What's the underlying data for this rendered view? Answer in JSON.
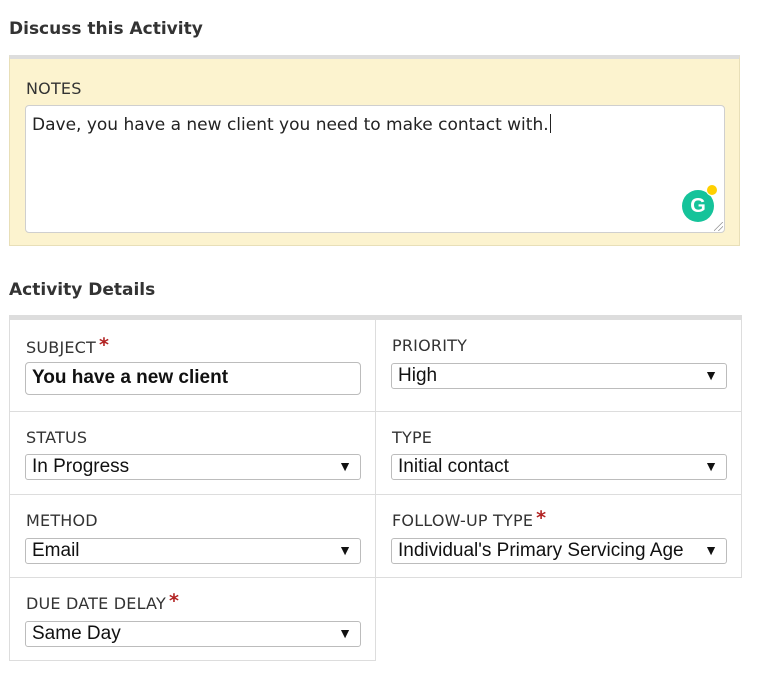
{
  "discuss": {
    "title": "Discuss this Activity",
    "notes_label": "NOTES",
    "notes_value": "Dave, you have a new client you need to make contact with."
  },
  "details": {
    "title": "Activity Details",
    "required_mark": "*",
    "arrow_glyph": "▼",
    "subject": {
      "label": "SUBJECT",
      "value": "You have a new client",
      "required": true
    },
    "priority": {
      "label": "PRIORITY",
      "value": "High"
    },
    "status": {
      "label": "STATUS",
      "value": "In Progress"
    },
    "type": {
      "label": "TYPE",
      "value": "Initial contact"
    },
    "method": {
      "label": "METHOD",
      "value": "Email"
    },
    "followup_type": {
      "label": "FOLLOW-UP TYPE",
      "value": "Individual's Primary Servicing Age",
      "required": true
    },
    "due_date_delay": {
      "label": "DUE DATE DELAY",
      "value": "Same Day",
      "required": true
    }
  },
  "colors": {
    "notes_background": "#fcf3cf",
    "required": "#b22222",
    "grammarly": "#15c39a"
  },
  "icons": {
    "grammarly": "grammarly-g-icon",
    "dropdown": "chevron-down-icon"
  }
}
